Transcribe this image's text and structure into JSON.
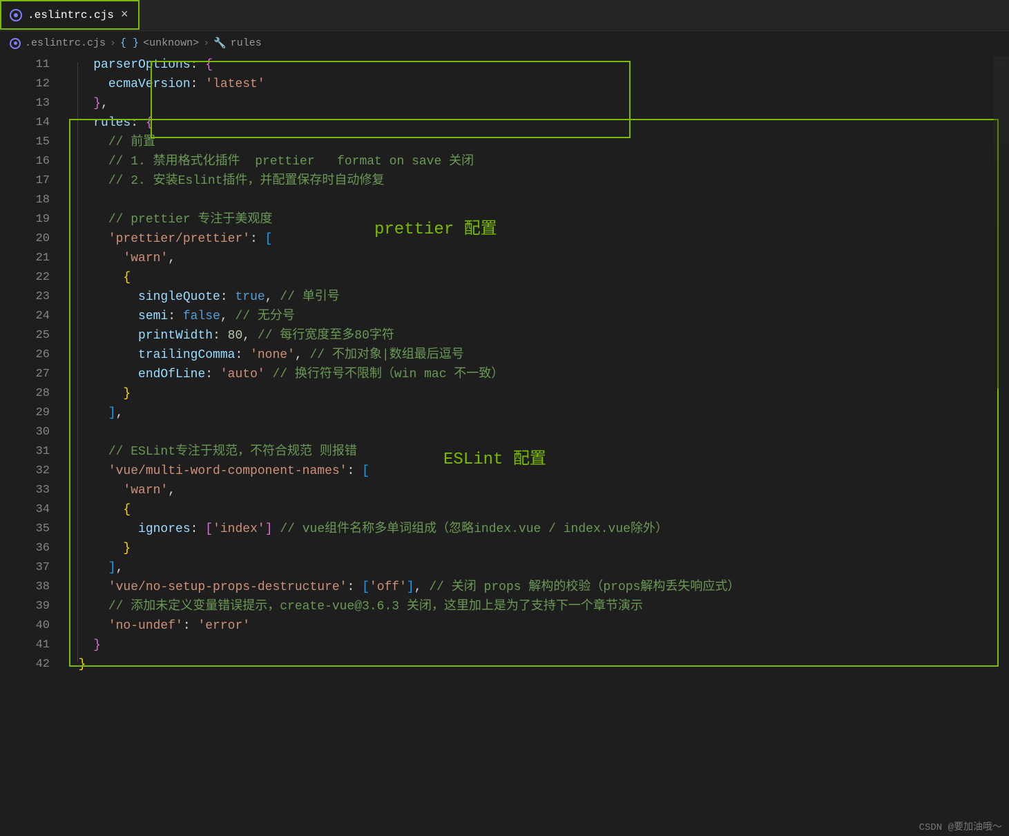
{
  "tab": {
    "filename": ".eslintrc.cjs",
    "close": "×"
  },
  "breadcrumb": {
    "file": ".eslintrc.cjs",
    "sep": "›",
    "node1": "<unknown>",
    "node2": "rules"
  },
  "annotations": {
    "prettier_label": "prettier 配置",
    "eslint_label": "ESLint 配置"
  },
  "watermark": "CSDN @要加油哦～",
  "gutter": {
    "start": 11,
    "end": 42
  },
  "code": {
    "l11": {
      "prop": "parserOptions",
      "punc": ": ",
      "brace": "{"
    },
    "l12": {
      "prop": "ecmaVersion",
      "punc": ": ",
      "str": "'latest'"
    },
    "l13": {
      "brace": "}",
      "comma": ","
    },
    "l14": {
      "prop": "rules",
      "punc": ": ",
      "brace": "{"
    },
    "l15": {
      "comment": "// 前置"
    },
    "l16": {
      "comment": "// 1. 禁用格式化插件  prettier   format on save 关闭"
    },
    "l17": {
      "comment": "// 2. 安装Eslint插件，并配置保存时自动修复"
    },
    "l19": {
      "comment": "// prettier 专注于美观度"
    },
    "l20": {
      "str": "'prettier/prettier'",
      "punc": ": ",
      "brack": "["
    },
    "l21": {
      "str": "'warn'",
      "comma": ","
    },
    "l22": {
      "brace": "{"
    },
    "l23": {
      "prop": "singleQuote",
      "punc": ": ",
      "val": "true",
      "comma": ",",
      "comment": " // 单引号"
    },
    "l24": {
      "prop": "semi",
      "punc": ": ",
      "val": "false",
      "comma": ",",
      "comment": " // 无分号"
    },
    "l25": {
      "prop": "printWidth",
      "punc": ": ",
      "val": "80",
      "comma": ",",
      "comment": " // 每行宽度至多80字符"
    },
    "l26": {
      "prop": "trailingComma",
      "punc": ": ",
      "val": "'none'",
      "comma": ",",
      "comment": " // 不加对象|数组最后逗号"
    },
    "l27": {
      "prop": "endOfLine",
      "punc": ": ",
      "val": "'auto'",
      "comment": " // 换行符号不限制（win mac 不一致）"
    },
    "l28": {
      "brace": "}"
    },
    "l29": {
      "brack": "]",
      "comma": ","
    },
    "l31": {
      "comment": "// ESLint专注于规范，不符合规范 则报错"
    },
    "l32": {
      "str": "'vue/multi-word-component-names'",
      "punc": ": ",
      "brack": "["
    },
    "l33": {
      "str": "'warn'",
      "comma": ","
    },
    "l34": {
      "brace": "{"
    },
    "l35": {
      "prop": "ignores",
      "punc": ": ",
      "brack_o": "[",
      "val": "'index'",
      "brack_c": "]",
      "comment": " // vue组件名称多单词组成（忽略index.vue / index.vue除外）"
    },
    "l36": {
      "brace": "}"
    },
    "l37": {
      "brack": "]",
      "comma": ","
    },
    "l38": {
      "str": "'vue/no-setup-props-destructure'",
      "punc": ": ",
      "brack_o": "[",
      "val": "'off'",
      "brack_c": "]",
      "comma": ",",
      "comment": " // 关闭 props 解构的校验（props解构丢失响应式）"
    },
    "l39": {
      "comment": "// 添加未定义变量错误提示，create-vue@3.6.3 关闭，这里加上是为了支持下一个章节演示"
    },
    "l40": {
      "str": "'no-undef'",
      "punc": ": ",
      "val": "'error'"
    },
    "l41": {
      "brace": "}"
    },
    "l42": {
      "brace": "}"
    }
  }
}
